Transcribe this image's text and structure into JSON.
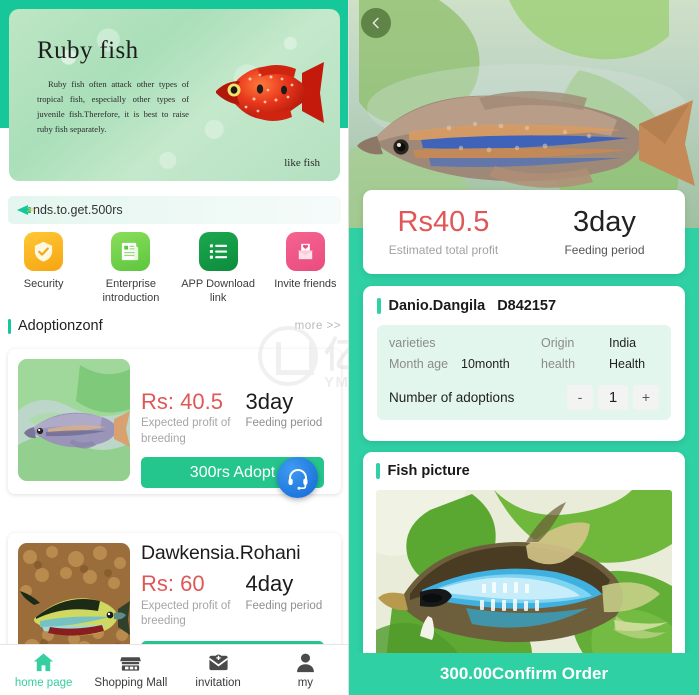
{
  "left": {
    "hero": {
      "title": "Ruby fish",
      "body": "Ruby fish often attack other types of tropical fish, especially other types of juvenile fish.Therefore, it is best to raise ruby fish separately.",
      "caption": "like fish"
    },
    "notice": {
      "text": "nds.to.get.500rs",
      "icon": "megaphone-icon"
    },
    "quick_actions": [
      {
        "label": "Security",
        "icon": "shield-check-icon"
      },
      {
        "label": "Enterprise introduction",
        "icon": "document-icon"
      },
      {
        "label": "APP Download link",
        "icon": "list-icon"
      },
      {
        "label": "Invite friends",
        "icon": "invite-heart-icon"
      }
    ],
    "section": {
      "title": "Adoptionzonf",
      "more": "more >>"
    },
    "watermark": {
      "cn": "亿码酷站",
      "en": "YMKUZHAN"
    },
    "cards": [
      {
        "name": "",
        "price": "Rs: 40.5",
        "price_caption": "Expected profit of breeding",
        "days": "3day",
        "days_caption": "Feeding period",
        "button": "300rs Adopt"
      },
      {
        "name": "Dawkensia.Rohani",
        "price": "Rs: 60",
        "price_caption": "Expected profit of breeding",
        "days": "4day",
        "days_caption": "Feeding period",
        "button": ""
      }
    ],
    "support": {
      "icon": "headset-icon"
    },
    "tabs": [
      {
        "label": "home page",
        "icon": "home-icon",
        "active": true
      },
      {
        "label": "Shopping Mall",
        "icon": "store-icon",
        "active": false
      },
      {
        "label": "invitation",
        "icon": "envelope-plus-icon",
        "active": false
      },
      {
        "label": "my",
        "icon": "person-icon",
        "active": false
      }
    ]
  },
  "right": {
    "back": {
      "icon": "chevron-left-icon"
    },
    "profit": {
      "amount": "Rs40.5",
      "amount_caption": "Estimated total profit",
      "period": "3day",
      "period_caption": "Feeding period"
    },
    "info": {
      "title": "Danio.Dangila",
      "id": "D842157",
      "rows": [
        {
          "k1": "varieties",
          "v1": "",
          "k2": "Origin",
          "v2": "India"
        },
        {
          "k1": "Month age",
          "v1": "10month",
          "k2": "health",
          "v2": "Health"
        }
      ],
      "adoptions_label": "Number of adoptions",
      "minus": "-",
      "quantity": "1",
      "plus": "+"
    },
    "picture": {
      "title": "Fish picture"
    },
    "confirm": {
      "label": "300.00Confirm Order"
    }
  },
  "colors": {
    "accent_teal": "#2fd0a4",
    "brand_green": "#16c79a",
    "price_red": "#e05757",
    "button_green": "#25c68d"
  }
}
